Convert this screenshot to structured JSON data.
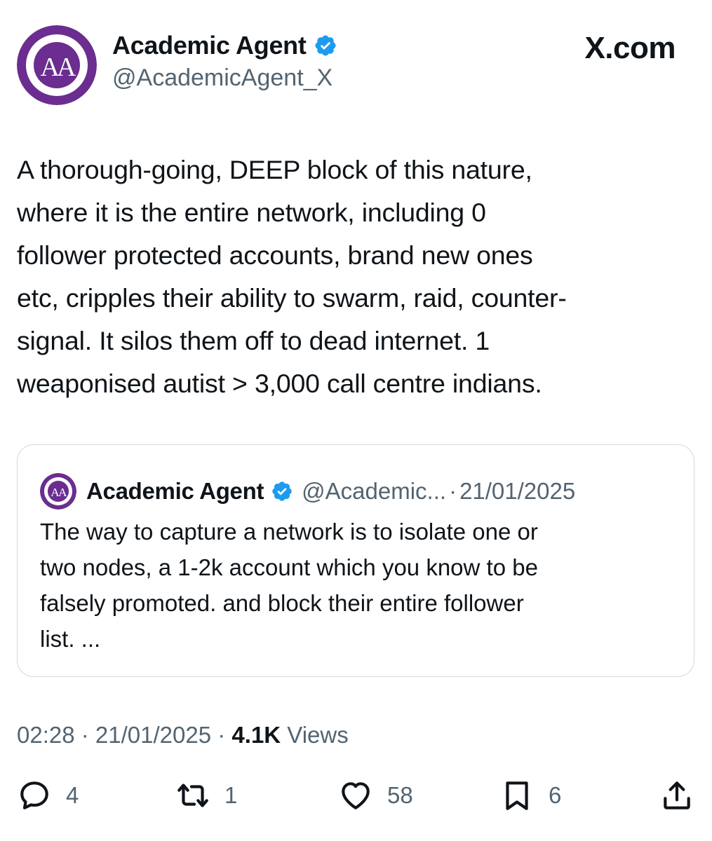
{
  "tweet": {
    "author": {
      "display_name": "Academic Agent",
      "handle": "@AcademicAgent_X",
      "verified": true,
      "avatar_icon": "academic-agency-logo"
    },
    "brand_label": "X.com",
    "text_lines": [
      "A thorough-going, DEEP block of this nature,",
      "where it is the entire network, including 0",
      "follower protected accounts, brand new ones",
      "etc, cripples their ability to swarm, raid, counter-",
      "signal. It silos them off to dead internet. 1",
      "weaponised autist > 3,000 call centre indians."
    ],
    "quoted": {
      "display_name": "Academic Agent",
      "handle": "@Academic...",
      "separator": "·",
      "date": "21/01/2025",
      "text_lines": [
        "The way to capture a network is to isolate one or",
        "two nodes, a 1-2k account which you know to be",
        "falsely promoted. and block their entire follower",
        "list. ..."
      ]
    },
    "meta": {
      "time": "02:28",
      "sep1": " · ",
      "date": "21/01/2025",
      "sep2": " · ",
      "views_count": "4.1K",
      "views_label": " Views"
    },
    "actions": {
      "replies": "4",
      "reposts": "1",
      "likes": "58",
      "bookmarks": "6"
    },
    "colors": {
      "avatar_purple": "#6b2d8f",
      "verified_blue": "#1d9bf0",
      "text": "#0f1419",
      "secondary_text": "#536471",
      "border": "#cfd9de"
    }
  }
}
